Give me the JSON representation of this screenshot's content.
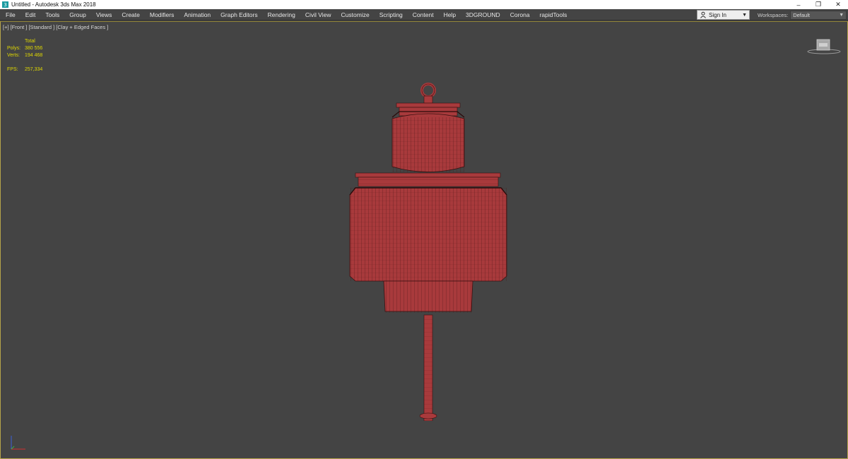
{
  "window": {
    "title": "Untitled - Autodesk 3ds Max 2018",
    "controls": {
      "minimize": "–",
      "restore": "❐",
      "close": "✕"
    }
  },
  "menu": {
    "items": [
      "File",
      "Edit",
      "Tools",
      "Group",
      "Views",
      "Create",
      "Modifiers",
      "Animation",
      "Graph Editors",
      "Rendering",
      "Civil View",
      "Customize",
      "Scripting",
      "Content",
      "Help",
      "3DGROUND",
      "Corona",
      "rapidTools"
    ]
  },
  "signin": {
    "label": "Sign In"
  },
  "workspaces": {
    "label": "Workspaces:",
    "value": "Default"
  },
  "viewport": {
    "label": "[+] [Front ] [Standard ] [Clay + Edged Faces ]",
    "stats": {
      "header": "Total",
      "polys_label": "Polys:",
      "polys_value": "380 556",
      "verts_label": "Verts:",
      "verts_value": "194 468",
      "fps_label": "FPS:",
      "fps_value": "257,334"
    },
    "model_color": "#a83a3c",
    "wire_color": "#3a1010",
    "stats_color": "#e0d800",
    "frame_color": "#b5a34a"
  }
}
